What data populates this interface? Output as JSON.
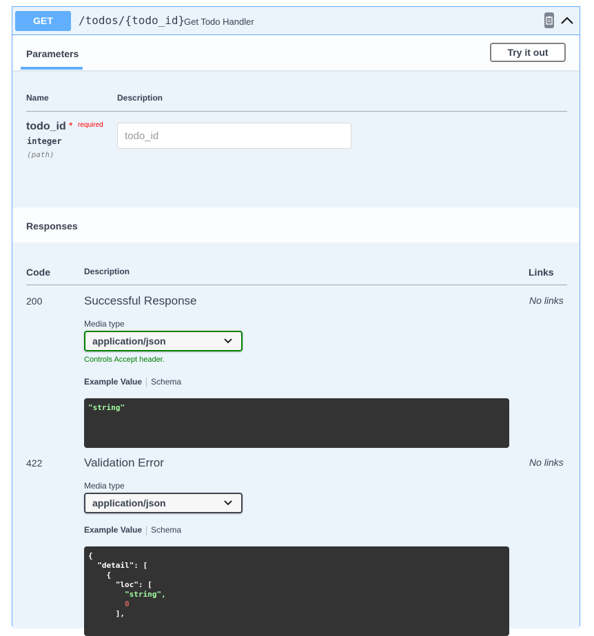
{
  "operation": {
    "method": "GET",
    "path": "/todos/{todo_id}",
    "summary": "Get Todo Handler"
  },
  "icons": {
    "copy": "copy-to-clipboard-icon",
    "collapse": "chevron-up-icon",
    "select_arrow": "chevron-down-icon"
  },
  "colors": {
    "get_accent": "#61affe",
    "required": "#ff0000",
    "valid_select": "#008000",
    "code_background": "#333333"
  },
  "parameters": {
    "tab_label": "Parameters",
    "try_it_out_label": "Try it out",
    "columns": {
      "name": "Name",
      "description": "Description"
    },
    "items": [
      {
        "name": "todo_id",
        "required_marker": "*",
        "required_label": "required",
        "type": "integer",
        "in": "(path)",
        "placeholder": "todo_id",
        "value": ""
      }
    ]
  },
  "responses": {
    "title": "Responses",
    "columns": {
      "code": "Code",
      "description": "Description",
      "links": "Links"
    },
    "media_type_label": "Media type",
    "example_tab_label": "Example Value",
    "schema_tab_label": "Schema",
    "items": [
      {
        "code": "200",
        "description": "Successful Response",
        "links": "No links",
        "media_type": "application/json",
        "media_note": "Controls Accept header."
      },
      {
        "code": "422",
        "description": "Validation Error",
        "links": "No links",
        "media_type": "application/json"
      }
    ],
    "example_200": {
      "string_value": "\"string\""
    },
    "example_422": {
      "open_brace": "{",
      "detail_key": "\"detail\"",
      "detail_open": ": [",
      "item_open": "{",
      "loc_key": "\"loc\"",
      "loc_open": ": [",
      "loc_string": "\"string\",",
      "loc_number": "0",
      "loc_close": "],"
    }
  }
}
